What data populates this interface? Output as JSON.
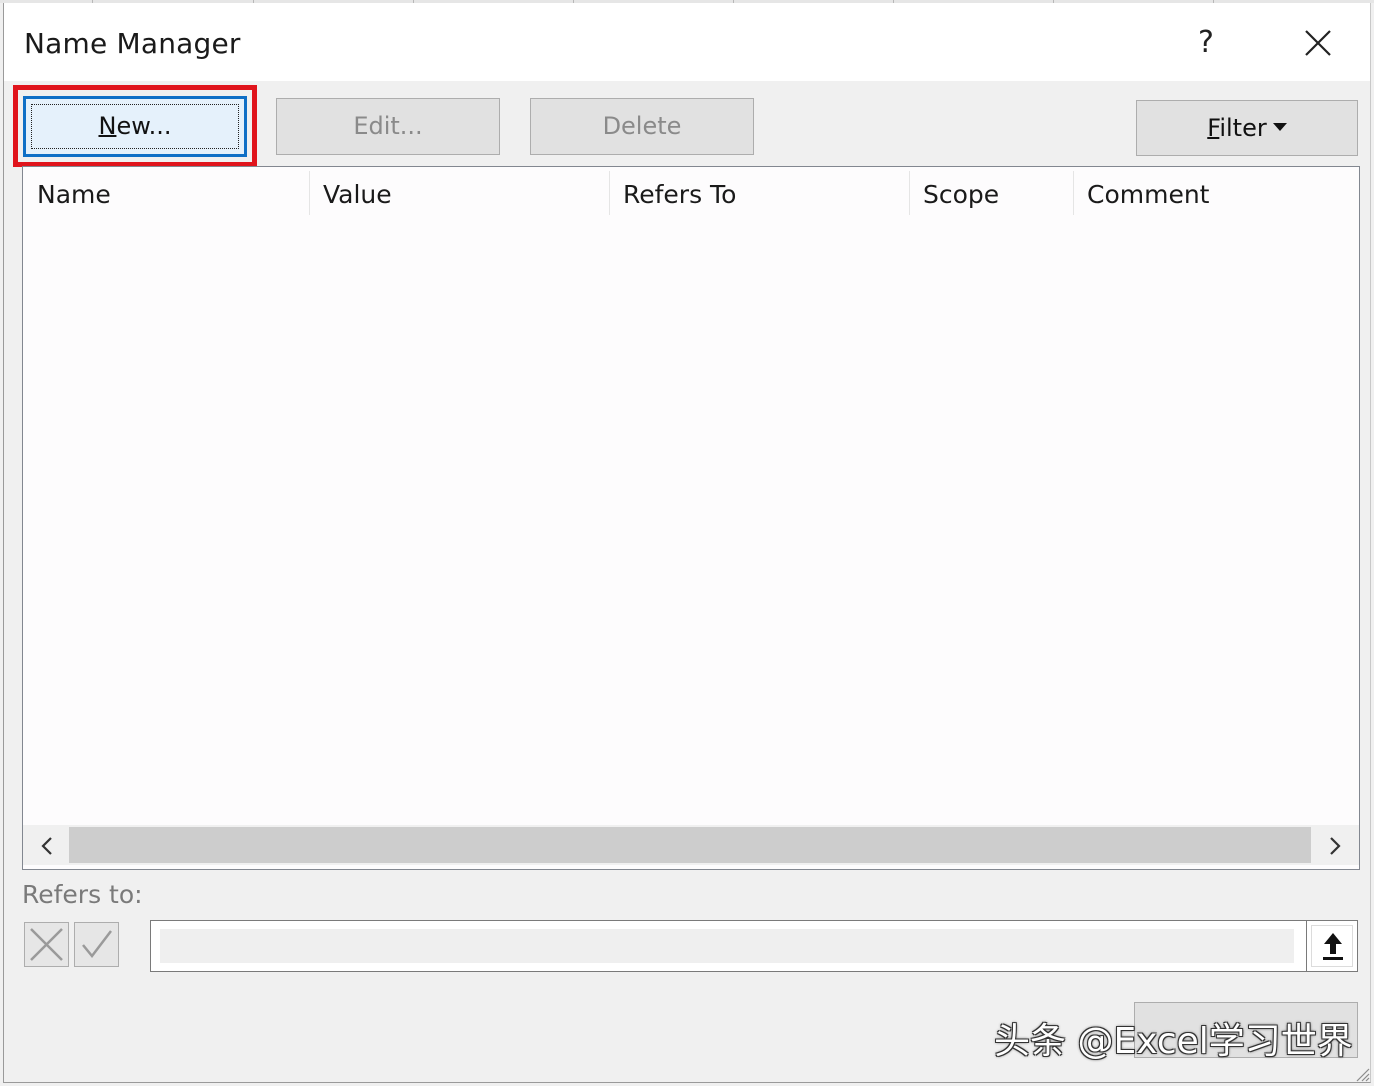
{
  "dialog": {
    "title": "Name Manager",
    "help_label": "?",
    "icons": {
      "close": "close-icon",
      "help": "help-icon"
    }
  },
  "toolbar": {
    "new_label": "New...",
    "edit_label": "Edit...",
    "delete_label": "Delete",
    "filter_label": "Filter"
  },
  "list": {
    "columns": [
      "Name",
      "Value",
      "Refers To",
      "Scope",
      "Comment"
    ],
    "rows": []
  },
  "refers_to": {
    "label": "Refers to:",
    "value": ""
  },
  "watermark": "头条 @Excel学习世界",
  "colors": {
    "highlight": "#e0141c",
    "focus_border": "#0f6fc6",
    "disabled_text": "#8a8a8a"
  }
}
